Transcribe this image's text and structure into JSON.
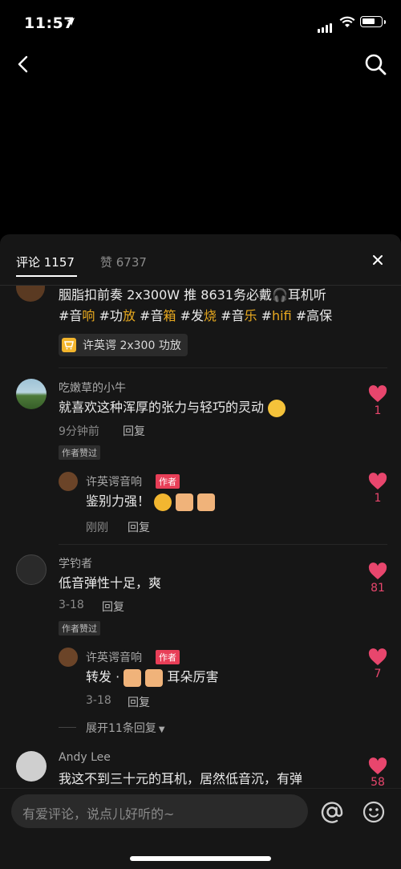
{
  "status": {
    "time": "11:57"
  },
  "tabs": {
    "comments": "评论 1157",
    "likes": "赞 6737"
  },
  "post": {
    "line1": "胭脂扣前奏 2x300W 推 8631务必戴🎧耳机听",
    "hashtags": [
      "#音",
      "响",
      " #功",
      "放",
      " #音",
      "箱",
      " #发",
      "烧",
      " #音",
      "乐",
      " #",
      "hifi",
      " #高保"
    ],
    "product": "许英谔 2x300 功放"
  },
  "comments": [
    {
      "name": "吃嫩草的小牛",
      "text": "就喜欢这种浑厚的张力与轻巧的灵动",
      "time": "9分钟前",
      "reply": "回复",
      "badge": "作者赞过",
      "likes": "1",
      "replies": [
        {
          "name": "许英谔音响",
          "tag": "作者",
          "text": "鉴别力强！",
          "time": "刚刚",
          "reply": "回复",
          "likes": "1"
        }
      ]
    },
    {
      "name": "学钓者",
      "text": "低音弹性十足，爽",
      "time": "3-18",
      "reply": "回复",
      "badge": "作者赞过",
      "likes": "81",
      "replies": [
        {
          "name": "许英谔音响",
          "tag": "作者",
          "text": "转发 · ",
          "text2": "耳朵厉害",
          "time": "3-18",
          "reply": "回复",
          "likes": "7"
        }
      ],
      "expand": "展开11条回复"
    },
    {
      "name": "Andy Lee",
      "text": "我这不到三十元的耳机，居然低音沉，有弹",
      "likes": "58"
    }
  ],
  "input": {
    "placeholder": "有爱评论，说点儿好听的~"
  },
  "icons": [
    "back-icon",
    "search-icon",
    "close-icon",
    "heart-icon",
    "at-icon",
    "emoji-icon",
    "cart-icon"
  ],
  "colors": {
    "accent": "#e8466d",
    "hashtag": "#e8a91f",
    "author": "#e83e57"
  }
}
